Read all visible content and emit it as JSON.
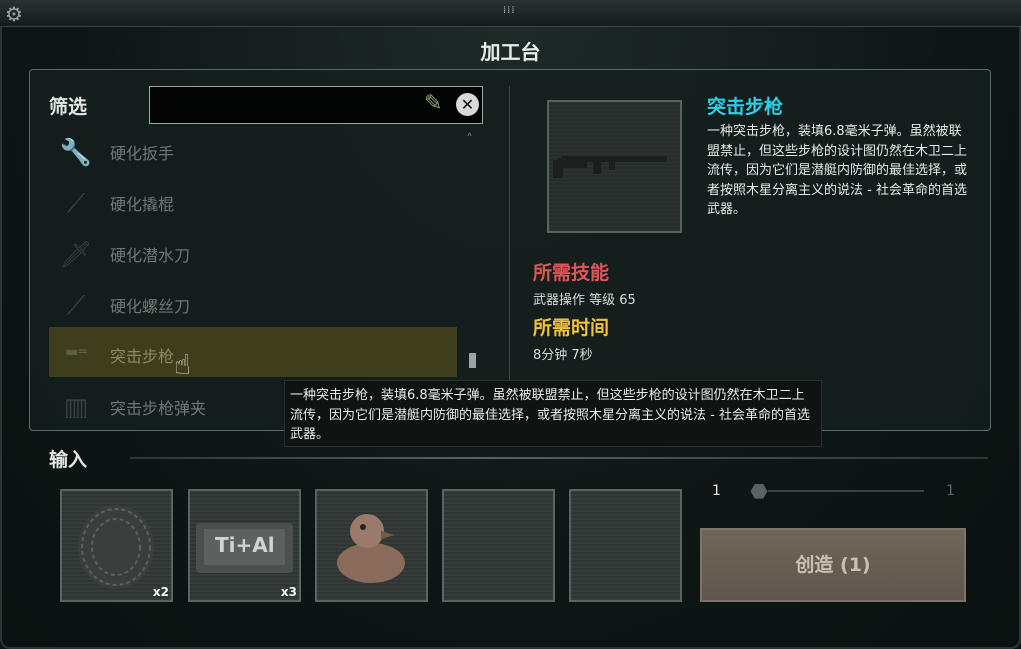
{
  "window": {
    "title": "加工台"
  },
  "filter": {
    "label": "筛选",
    "value": ""
  },
  "list": {
    "items": [
      {
        "label": "硬化扳手",
        "icon": "wrench-icon",
        "selected": false
      },
      {
        "label": "硬化撬棍",
        "icon": "crowbar-icon",
        "selected": false
      },
      {
        "label": "硬化潜水刀",
        "icon": "knife-icon",
        "selected": false
      },
      {
        "label": "硬化螺丝刀",
        "icon": "screwdriver-icon",
        "selected": false
      },
      {
        "label": "突击步枪",
        "icon": "rifle-icon",
        "selected": true
      },
      {
        "label": "突击步枪弹夹",
        "icon": "magazine-icon",
        "selected": false
      }
    ]
  },
  "detail": {
    "name": "突击步枪",
    "description": "一种突击步枪，装填6.8毫米子弹。虽然被联盟禁止，但这些步枪的设计图仍然在木卫二上流传，因为它们是潜艇内防御的最佳选择，或者按照木星分离主义的说法 - 社会革命的首选武器。",
    "required_skill_heading": "所需技能",
    "required_skill": "武器操作 等级 65",
    "required_time_heading": "所需时间",
    "required_time": "8分钟 7秒"
  },
  "tooltip": {
    "text": "一种突击步枪，装填6.8毫米子弹。虽然被联盟禁止，但这些步枪的设计图仍然在木卫二上流传，因为它们是潜艇内防御的最佳选择，或者按照木星分离主义的说法 - 社会革命的首选武器。"
  },
  "input": {
    "label": "输入",
    "slots": [
      {
        "item": "sponge-material",
        "qty": "x2"
      },
      {
        "item": "ti-al-ingot",
        "qty": "x3",
        "text": "Ti+Al"
      },
      {
        "item": "rubber-duck",
        "qty": ""
      },
      {
        "item": "empty",
        "qty": ""
      },
      {
        "item": "empty",
        "qty": ""
      }
    ]
  },
  "quantity": {
    "min": "1",
    "max": "1"
  },
  "create_button": {
    "label": "创造 (1)"
  },
  "colors": {
    "item_name": "#2ed0e4",
    "skill_heading": "#e05656",
    "time_heading": "#f0c23a",
    "selected_row": "#3e3d1c"
  }
}
